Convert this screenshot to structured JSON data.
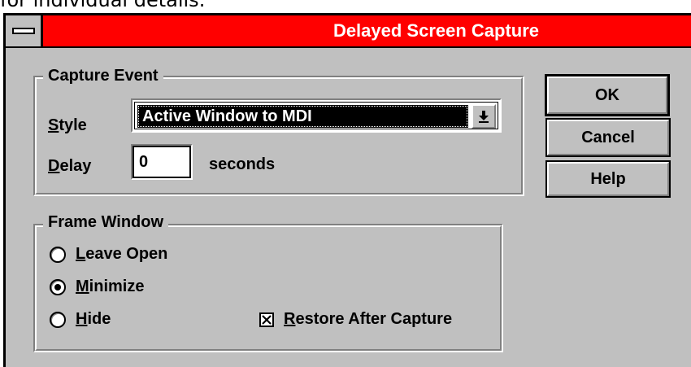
{
  "background_text": "for individual details.",
  "dialog": {
    "title": "Delayed Screen Capture",
    "title_bg": "#ff0000"
  },
  "capture_event": {
    "group_label": "Capture Event",
    "style_label_first": "S",
    "style_label_rest": "tyle",
    "style_value": "Active Window to MDI",
    "delay_label_first": "D",
    "delay_label_rest": "elay",
    "delay_value": "0",
    "delay_unit": "seconds"
  },
  "frame_window": {
    "group_label": "Frame Window",
    "options": [
      {
        "first": "L",
        "rest": "eave Open",
        "selected": false
      },
      {
        "first": "M",
        "rest": "inimize",
        "selected": true
      },
      {
        "first": "H",
        "rest": "ide",
        "selected": false
      }
    ],
    "restore": {
      "first": "R",
      "rest": "estore After Capture",
      "checked": true
    }
  },
  "buttons": {
    "ok": "OK",
    "cancel": "Cancel",
    "help": "Help"
  }
}
